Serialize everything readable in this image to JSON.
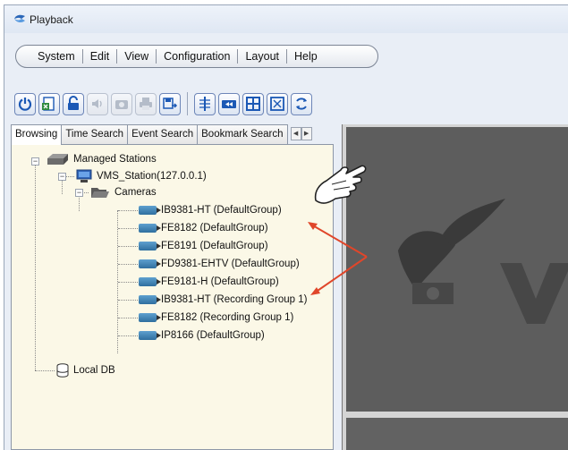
{
  "window": {
    "title": "Playback"
  },
  "menu": [
    "System",
    "Edit",
    "View",
    "Configuration",
    "Layout",
    "Help"
  ],
  "toolbar": {
    "buttons": [
      {
        "icon": "power-icon",
        "enabled": true
      },
      {
        "icon": "export-excel-icon",
        "enabled": true
      },
      {
        "icon": "unlock-icon",
        "enabled": true
      },
      {
        "icon": "speaker-icon",
        "enabled": false
      },
      {
        "icon": "camera-snapshot-icon",
        "enabled": false
      },
      {
        "icon": "print-icon",
        "enabled": false
      },
      {
        "icon": "save-export-icon",
        "enabled": true
      }
    ],
    "buttons2": [
      {
        "icon": "sync-icon",
        "enabled": true
      },
      {
        "icon": "video-speed-icon",
        "enabled": true
      },
      {
        "icon": "layout-grid-icon",
        "enabled": true
      },
      {
        "icon": "fullscreen-icon",
        "enabled": true
      },
      {
        "icon": "refresh-icon",
        "enabled": true
      }
    ]
  },
  "tabs": [
    "Browsing",
    "Time Search",
    "Event Search",
    "Bookmark Search"
  ],
  "tree": {
    "root": "Managed Stations",
    "station": "VMS_Station(127.0.0.1)",
    "cameras_folder": "Cameras",
    "cameras": [
      "IB9381-HT (DefaultGroup)",
      "FE8182 (DefaultGroup)",
      "FE8191 (DefaultGroup)",
      "FD9381-EHTV (DefaultGroup)",
      "FE9181-H (DefaultGroup)",
      "IB9381-HT (Recording Group 1)",
      "FE8182 (Recording Group 1)",
      "IP8166 (DefaultGroup)"
    ],
    "local": "Local DB"
  },
  "colors": {
    "tree_bg": "#fbf8e7",
    "accent": "#1f5fbf",
    "arrow": "#e0462a"
  }
}
